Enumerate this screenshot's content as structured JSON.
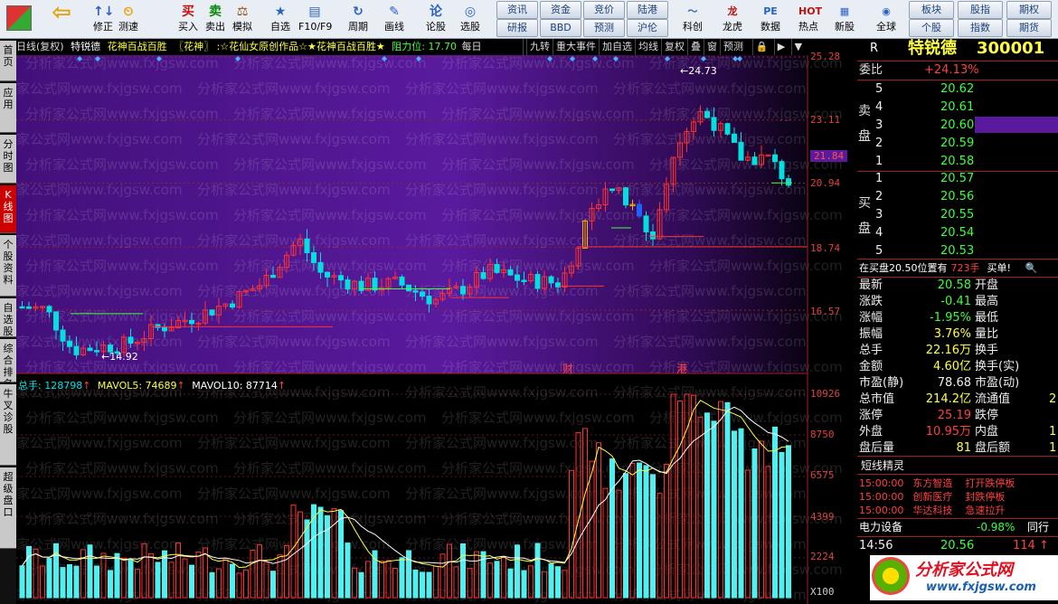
{
  "toolbar": {
    "main_buttons": [
      {
        "label": "修正",
        "icon": "↑↓"
      },
      {
        "label": "测速",
        "icon": "⏲"
      },
      {
        "label": "买入",
        "icon": "买"
      },
      {
        "label": "卖出",
        "icon": "卖"
      },
      {
        "label": "模拟",
        "icon": "⚖"
      },
      {
        "label": "自选",
        "icon": "★"
      },
      {
        "label": "F10/F9",
        "icon": "▤"
      },
      {
        "label": "周期",
        "icon": "↻"
      },
      {
        "label": "画线",
        "icon": "✎"
      },
      {
        "label": "论股",
        "icon": "论"
      },
      {
        "label": "选股",
        "icon": "◎"
      }
    ],
    "mid_buttons_top": [
      "资讯",
      "资金",
      "竞价",
      "陆港"
    ],
    "mid_buttons_bottom": [
      "研报",
      "BBD",
      "预测",
      "沪伦"
    ],
    "icon_buttons": [
      {
        "label": "科创",
        "icon": "〜"
      },
      {
        "label": "龙虎",
        "icon": "龙"
      },
      {
        "label": "数据",
        "icon": "PE"
      },
      {
        "label": "热点",
        "icon": "HOT"
      },
      {
        "label": "新股",
        "icon": "▦"
      },
      {
        "label": "全球",
        "icon": "◉"
      }
    ],
    "right_buttons_top": [
      "板块",
      "股指",
      "期权"
    ],
    "right_buttons_bottom": [
      "个股",
      "指数",
      "期货"
    ]
  },
  "sidebar": [
    "首页",
    "应用",
    "分时图",
    "K线图",
    "个股资料",
    "自选股",
    "综合排名",
    "牛叉诊股",
    "超级盘口"
  ],
  "chart_header": {
    "period": "日线(复权)",
    "stock": "特锐德",
    "strategy": "花神百战百胜",
    "tag": "〖花神〗",
    "credit": ":☆花仙女原创作品☆★花神百战百胜★",
    "resistance": "阻力位: 17.70",
    "tail": "每日"
  },
  "chart_tabs": [
    "九转",
    "重大事件",
    "加自选",
    "均线",
    "复权",
    "叠",
    "窗",
    "预测"
  ],
  "price_axis": [
    "25.28",
    "23.11",
    "21.84",
    "20.94",
    "18.74",
    "16.57"
  ],
  "volume_axis": [
    "10926",
    "8750",
    "6575",
    "4399",
    "2224",
    "X100"
  ],
  "annotations": {
    "high": "24.73",
    "low": "14.92",
    "event1": "财",
    "event2": "港"
  },
  "volume_header": {
    "total": "总手: 128798",
    "mavol5": "MAVOL5: 74689",
    "mavol10": "MAVOL10: 87714"
  },
  "watermark": "分析家公式网www.fxjgsw.com",
  "quote": {
    "code": "R",
    "name": "特锐德",
    "symbol": "300001",
    "weibi_label": "委比",
    "weibi": "+24.13%",
    "sell_label": "卖盘",
    "buy_label": "买盘",
    "asks": [
      {
        "lvl": "5",
        "price": "20.62"
      },
      {
        "lvl": "4",
        "price": "20.61"
      },
      {
        "lvl": "3",
        "price": "20.60"
      },
      {
        "lvl": "2",
        "price": "20.59"
      },
      {
        "lvl": "1",
        "price": "20.58"
      }
    ],
    "bids": [
      {
        "lvl": "1",
        "price": "20.57"
      },
      {
        "lvl": "2",
        "price": "20.56"
      },
      {
        "lvl": "3",
        "price": "20.55"
      },
      {
        "lvl": "4",
        "price": "20.54"
      },
      {
        "lvl": "5",
        "price": "20.53"
      }
    ],
    "notice": "在买盘20.50位置有",
    "notice_vol": "723手",
    "notice_tail": "买单!",
    "stats": [
      {
        "l1": "最新",
        "v1": "20.58",
        "l2": "开盘",
        "v2": "",
        "c1": "grn"
      },
      {
        "l1": "涨跌",
        "v1": "-0.41",
        "l2": "最高",
        "v2": "",
        "c1": "grn"
      },
      {
        "l1": "涨幅",
        "v1": "-1.95%",
        "l2": "最低",
        "v2": "",
        "c1": "grn"
      },
      {
        "l1": "振幅",
        "v1": "3.76%",
        "l2": "量比",
        "v2": "",
        "c1": "yel"
      },
      {
        "l1": "总手",
        "v1": "22.16万",
        "l2": "换手",
        "v2": "",
        "c1": "yel"
      },
      {
        "l1": "金额",
        "v1": "4.60亿",
        "l2": "换手(实)",
        "v2": "",
        "c1": "yel"
      },
      {
        "l1": "市盈(静)",
        "v1": "78.68",
        "l2": "市盈(动)",
        "v2": "",
        "c1": "wht"
      },
      {
        "l1": "总市值",
        "v1": "214.2亿",
        "l2": "流通值",
        "v2": "2",
        "c1": "yel"
      },
      {
        "l1": "涨停",
        "v1": "25.19",
        "l2": "跌停",
        "v2": "",
        "c1": "red"
      },
      {
        "l1": "外盘",
        "v1": "10.95万",
        "l2": "内盘",
        "v2": "1",
        "c1": "red"
      },
      {
        "l1": "盘后量",
        "v1": "81",
        "l2": "盘后额",
        "v2": "1",
        "c1": "yel"
      }
    ],
    "sprite_title": "短线精灵",
    "sprites": [
      {
        "time": "15:00:00",
        "name": "东方智造",
        "event": "打开跌停板"
      },
      {
        "time": "15:00:00",
        "name": "创新医疗",
        "event": "封跌停板"
      },
      {
        "time": "15:00:00",
        "name": "华达科技",
        "event": "急速拉升"
      }
    ],
    "sector": "电力设备",
    "sector_pct": "-0.98%",
    "sector_tail": "同行",
    "tick_time": "14:56",
    "tick_price": "20.56",
    "tick_vol": "114",
    "logo_text": "分析家公式网",
    "logo_url": "www.fxjgsw.com"
  }
}
